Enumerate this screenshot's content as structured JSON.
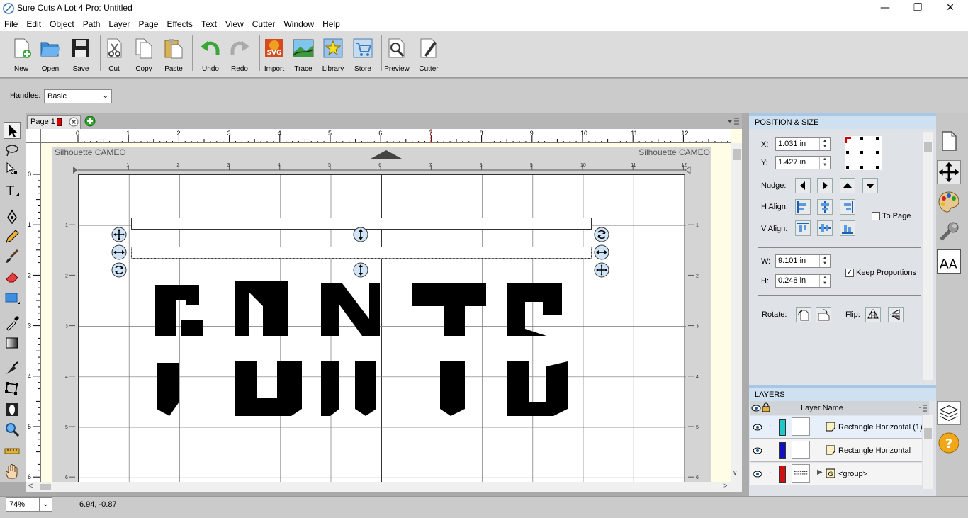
{
  "window": {
    "title": "Sure Cuts A Lot 4 Pro: Untitled",
    "minimize": "—",
    "maximize": "❐",
    "close": "✕"
  },
  "menu": [
    "File",
    "Edit",
    "Object",
    "Path",
    "Layer",
    "Page",
    "Effects",
    "Text",
    "View",
    "Cutter",
    "Window",
    "Help"
  ],
  "toolbar": {
    "new": "New",
    "open": "Open",
    "save": "Save",
    "cut": "Cut",
    "copy": "Copy",
    "paste": "Paste",
    "undo": "Undo",
    "redo": "Redo",
    "import": "Import",
    "trace": "Trace",
    "library": "Library",
    "store": "Store",
    "preview": "Preview",
    "cutter": "Cutter"
  },
  "handles": {
    "label": "Handles:",
    "value": "Basic"
  },
  "tab": {
    "label": "Page 1",
    "tab_color": "#e00000"
  },
  "canvas": {
    "mat_left_label": "Silhouette CAMEO",
    "mat_right_label": "Silhouette CAMEO",
    "hruler_ticks": [
      "0",
      "1",
      "2",
      "3",
      "4",
      "5",
      "6",
      "7",
      "8",
      "9",
      "10",
      "11",
      "12"
    ],
    "vruler_ticks": [
      "0",
      "1",
      "2",
      "3",
      "4",
      "5",
      "6"
    ],
    "mat_ticks": [
      "1",
      "2",
      "3",
      "4",
      "5",
      "6",
      "7",
      "8",
      "9",
      "10",
      "11",
      "12"
    ]
  },
  "position_size": {
    "header": "POSITION & SIZE",
    "x_label": "X:",
    "x_value": "1.031 in",
    "y_label": "Y:",
    "y_value": "1.427 in",
    "nudge_label": "Nudge:",
    "halign_label": "H Align:",
    "valign_label": "V Align:",
    "to_page": "To Page",
    "w_label": "W:",
    "w_value": "9.101 in",
    "h_label": "H:",
    "h_value": "0.248 in",
    "keep_proportions": "Keep Proportions",
    "keep_proportions_checked": "✓",
    "rotate_label": "Rotate:",
    "flip_label": "Flip:"
  },
  "layers": {
    "header": "LAYERS",
    "column_name": "Layer Name",
    "rows": [
      {
        "name": "Rectangle Horizontal (1)",
        "color": "#20c8c8"
      },
      {
        "name": "Rectangle Horizontal",
        "color": "#1010c0"
      },
      {
        "name": "<group>",
        "color": "#d01010"
      }
    ]
  },
  "status": {
    "zoom": "74%",
    "coords": "6.94, -0.87"
  }
}
